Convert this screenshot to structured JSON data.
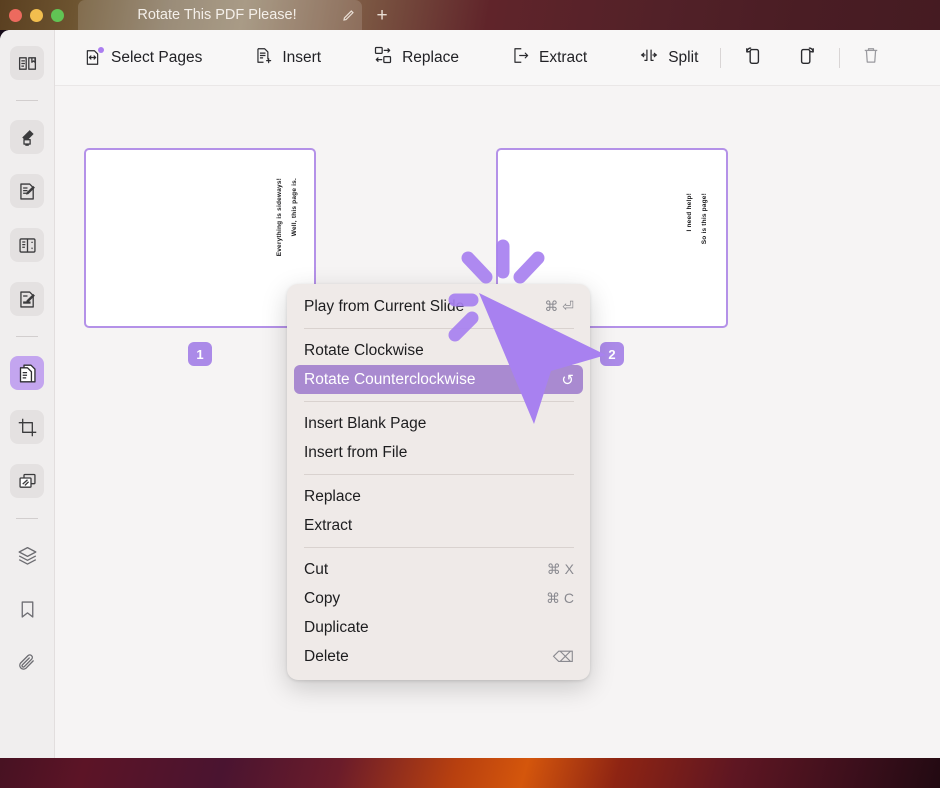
{
  "window": {
    "tab_title": "Rotate This PDF Please!",
    "edit_icon": "pencil-icon",
    "new_tab_icon": "plus-icon",
    "traffic_lights": [
      "close",
      "minimize",
      "maximize"
    ]
  },
  "sidebar": {
    "items": [
      {
        "name": "reader-view",
        "icon": "book-open-icon",
        "state": "tinted"
      },
      {
        "name": "highlighter",
        "icon": "highlighter-icon",
        "state": "tinted"
      },
      {
        "name": "annotate",
        "icon": "note-pencil-icon",
        "state": "tinted"
      },
      {
        "name": "reading-list",
        "icon": "list-panel-icon",
        "state": "tinted"
      },
      {
        "name": "signature",
        "icon": "sign-document-icon",
        "state": "tinted"
      },
      {
        "name": "organize-pages",
        "icon": "pages-icon",
        "state": "active"
      },
      {
        "name": "crop",
        "icon": "crop-icon",
        "state": "tinted"
      },
      {
        "name": "compress",
        "icon": "stack-pages-icon",
        "state": "tinted"
      },
      {
        "name": "layers",
        "icon": "layers-icon",
        "state": "plain"
      },
      {
        "name": "bookmarks",
        "icon": "bookmark-icon",
        "state": "plain"
      },
      {
        "name": "attachments",
        "icon": "paperclip-icon",
        "state": "plain"
      }
    ]
  },
  "toolbar": {
    "items": [
      {
        "label": "Select Pages",
        "icon": "select-pages-icon",
        "badge": true
      },
      {
        "label": "Insert",
        "icon": "insert-page-icon",
        "badge": false
      },
      {
        "label": "Replace",
        "icon": "replace-icon",
        "badge": false
      },
      {
        "label": "Extract",
        "icon": "extract-icon",
        "badge": false
      },
      {
        "label": "Split",
        "icon": "split-icon",
        "badge": false
      }
    ],
    "icon_buttons": [
      {
        "name": "rotate-left-button",
        "icon": "rotate-ccw-page-icon"
      },
      {
        "name": "rotate-right-button",
        "icon": "rotate-cw-page-icon"
      },
      {
        "name": "delete-button",
        "icon": "trash-icon"
      }
    ]
  },
  "pages": [
    {
      "number": "1",
      "lines": [
        "Everything is sideways!",
        "Well, this page is."
      ],
      "selected": true
    },
    {
      "number": "2",
      "lines": [
        "I need help!",
        "So is this page!"
      ],
      "selected": true
    }
  ],
  "context_menu": {
    "groups": [
      {
        "items": [
          {
            "label": "Play from Current Slide",
            "accel": "⌘ ⏎",
            "highlighted": false,
            "trailing_icon": ""
          }
        ]
      },
      {
        "items": [
          {
            "label": "Rotate Clockwise",
            "accel": "",
            "highlighted": false,
            "trailing_icon": "↻"
          },
          {
            "label": "Rotate Counterclockwise",
            "accel": "",
            "highlighted": true,
            "trailing_icon": "↺"
          }
        ]
      },
      {
        "items": [
          {
            "label": "Insert Blank Page",
            "accel": "",
            "highlighted": false,
            "trailing_icon": ""
          },
          {
            "label": "Insert from File",
            "accel": "",
            "highlighted": false,
            "trailing_icon": ""
          }
        ]
      },
      {
        "items": [
          {
            "label": "Replace",
            "accel": "",
            "highlighted": false,
            "trailing_icon": ""
          },
          {
            "label": "Extract",
            "accel": "",
            "highlighted": false,
            "trailing_icon": ""
          }
        ]
      },
      {
        "items": [
          {
            "label": "Cut",
            "accel": "⌘ X",
            "highlighted": false,
            "trailing_icon": ""
          },
          {
            "label": "Copy",
            "accel": "⌘ C",
            "highlighted": false,
            "trailing_icon": ""
          },
          {
            "label": "Duplicate",
            "accel": "",
            "highlighted": false,
            "trailing_icon": ""
          },
          {
            "label": "Delete",
            "accel": "⌫",
            "highlighted": false,
            "trailing_icon": ""
          }
        ]
      }
    ]
  },
  "cursor": {
    "name": "pointer-arrow",
    "color": "#a881f0",
    "has_click_burst": true
  },
  "colors": {
    "accent_purple": "#ab8ae8",
    "menu_highlight": "#a98ad0",
    "page_border": "#b491e8",
    "app_bg": "#f4f2f2",
    "toolbar_bg": "#f8f7f7"
  }
}
